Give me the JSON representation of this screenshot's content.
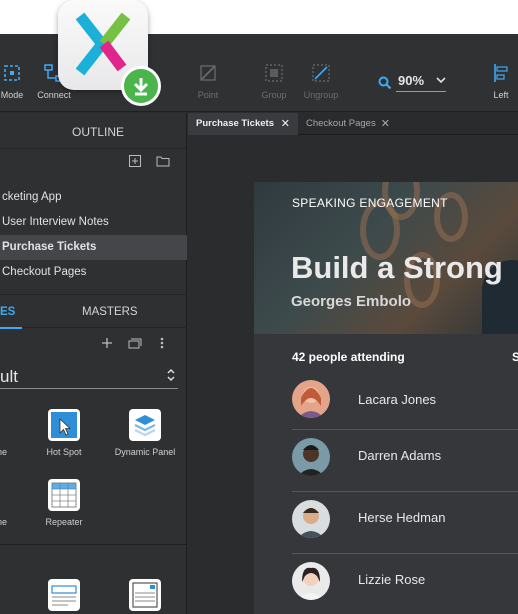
{
  "toolbar": {
    "mode_label": "Mode",
    "connect_label": "Connect",
    "point_label": "Point",
    "group_label": "Group",
    "ungroup_label": "Ungroup",
    "left_label": "Left",
    "zoom_value": "90%"
  },
  "outline": {
    "title": "OUTLINE",
    "items": [
      {
        "label": "cketing App"
      },
      {
        "label": "User Interview Notes"
      },
      {
        "label": "Purchase Tickets"
      },
      {
        "label": "Checkout Pages"
      }
    ]
  },
  "library": {
    "tabs": [
      {
        "label": "ES"
      },
      {
        "label": "MASTERS"
      }
    ],
    "selected_library": "ult",
    "widgets": [
      {
        "label": "ne"
      },
      {
        "label": "Hot Spot"
      },
      {
        "label": "Dynamic Panel"
      },
      {
        "label": "ne"
      },
      {
        "label": "Repeater"
      }
    ]
  },
  "doc_tabs": [
    {
      "label": "Purchase Tickets"
    },
    {
      "label": "Checkout Pages"
    }
  ],
  "artboard": {
    "eyebrow": "SPEAKING ENGAGEMENT",
    "headline": "Build a Strong",
    "speaker": "Georges Embolo",
    "attending": "42 people attending",
    "attending_extra": "S",
    "attendees": [
      {
        "name": "Lacara Jones",
        "avatar_color": "#c9785e"
      },
      {
        "name": "Darren Adams",
        "avatar_color": "#4a3528"
      },
      {
        "name": "Herse Hedman",
        "avatar_color": "#b98d6c"
      },
      {
        "name": "Lizzie Rose",
        "avatar_color": "#d9b7a0"
      }
    ]
  },
  "colors": {
    "accent": "#3fa9f5",
    "download_badge": "#49b54a"
  }
}
